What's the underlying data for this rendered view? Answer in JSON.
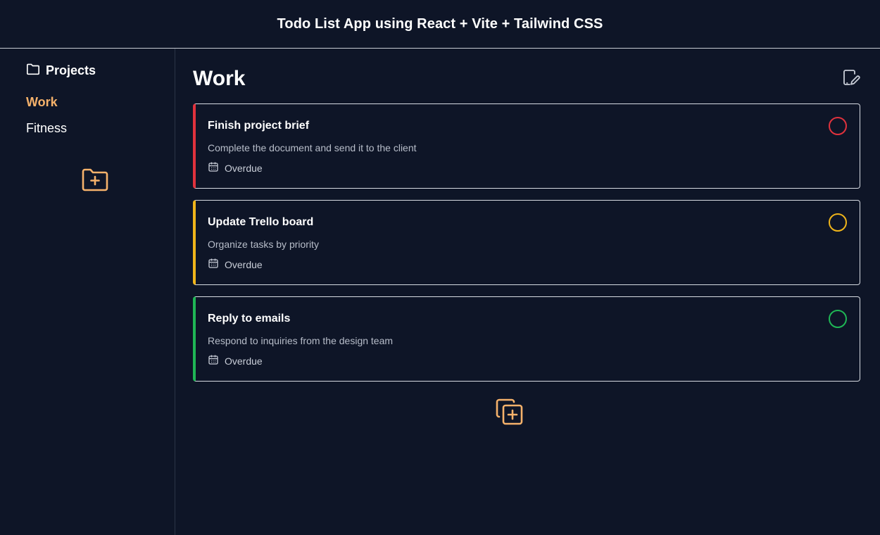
{
  "header": {
    "title": "Todo List App using React + Vite + Tailwind CSS"
  },
  "sidebar": {
    "heading": "Projects",
    "heading_icon": "folder-icon",
    "projects": [
      {
        "label": "Work",
        "active": true
      },
      {
        "label": "Fitness",
        "active": false
      }
    ],
    "add_icon": "folder-plus-icon"
  },
  "main": {
    "title": "Work",
    "edit_icon": "file-edit-icon",
    "tasks": [
      {
        "title": "Finish project brief",
        "description": "Complete the document and send it to the client",
        "date": "Overdue",
        "priority": "high"
      },
      {
        "title": "Update Trello board",
        "description": "Organize tasks by priority",
        "date": "Overdue",
        "priority": "medium"
      },
      {
        "title": "Reply to emails",
        "description": "Respond to inquiries from the design team",
        "date": "Overdue",
        "priority": "low"
      }
    ],
    "add_icon": "copy-plus-icon"
  },
  "colors": {
    "background": "#0e1527",
    "accent": "#f6b26b",
    "priority_high": "#e0323d",
    "priority_medium": "#f0b51a",
    "priority_low": "#1fb655"
  }
}
